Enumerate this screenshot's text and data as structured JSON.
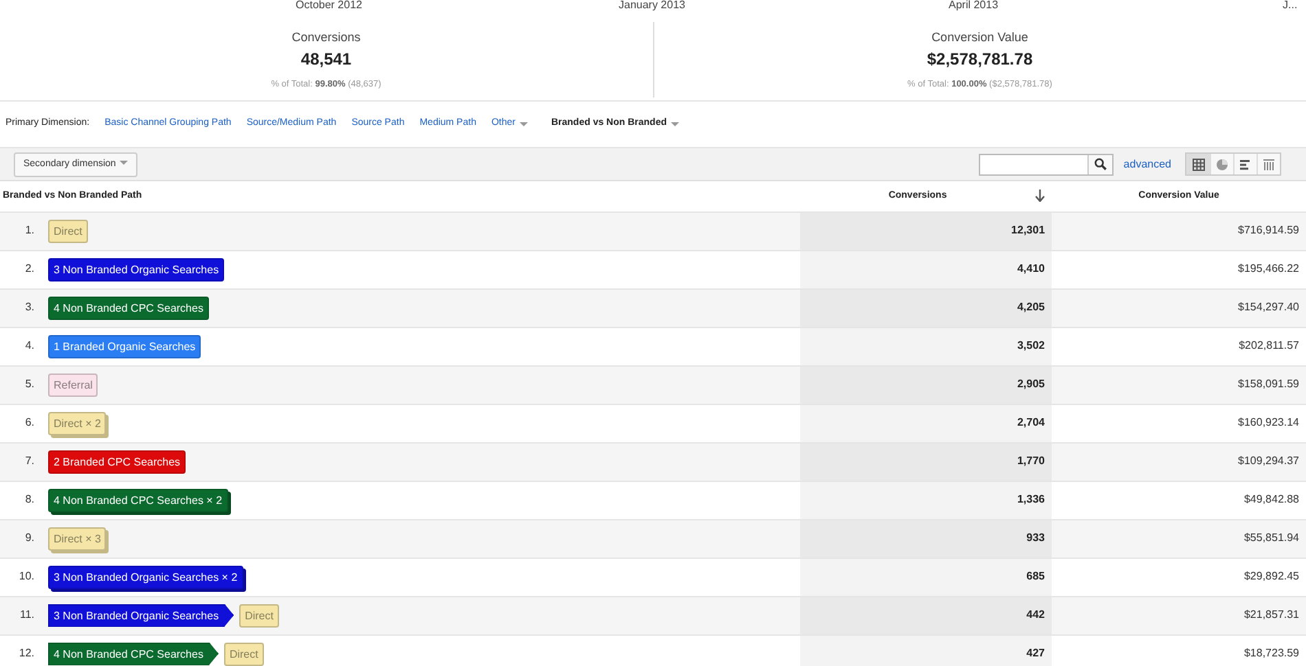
{
  "timeline_labels": [
    "October 2012",
    "January 2013",
    "April 2013",
    "J..."
  ],
  "scorecards": [
    {
      "label": "Conversions",
      "value": "48,541",
      "share": "% of Total: **99.80%** (48,637)"
    },
    {
      "label": "Conversion Value",
      "value": "$2,578,781.78",
      "share": "% of Total: **100.00%** ($2,578,781.78)"
    }
  ],
  "primary_dimension": {
    "label": "Primary Dimension:",
    "options": [
      {
        "label": "Basic Channel Grouping Path",
        "selected": false,
        "dropdown": false
      },
      {
        "label": "Source/Medium Path",
        "selected": false,
        "dropdown": false
      },
      {
        "label": "Source Path",
        "selected": false,
        "dropdown": false
      },
      {
        "label": "Medium Path",
        "selected": false,
        "dropdown": false
      },
      {
        "label": "Other",
        "selected": false,
        "dropdown": true
      },
      {
        "label": "Branded vs Non Branded",
        "selected": true,
        "dropdown": true
      }
    ]
  },
  "secondary_dimension": "Secondary dimension",
  "advanced_link": "advanced",
  "view_buttons": [
    {
      "kind": "table",
      "selected": true
    },
    {
      "kind": "pie",
      "selected": false
    },
    {
      "kind": "bars",
      "selected": false
    },
    {
      "kind": "columns",
      "selected": false
    }
  ],
  "table": {
    "columns": [
      "Branded vs Non Branded Path",
      "Conversions",
      "Conversion Value"
    ],
    "rows": [
      {
        "index": "1.",
        "path": [
          {
            "label": "Direct",
            "color": "#f5e6a8",
            "stacked": false
          }
        ],
        "conversions": "12,301",
        "value": "$716,914.59"
      },
      {
        "index": "2.",
        "path": [
          {
            "label": "3 Non Branded Organic Searches",
            "color": "#1010d8",
            "stacked": false
          }
        ],
        "conversions": "4,410",
        "value": "$195,466.22"
      },
      {
        "index": "3.",
        "path": [
          {
            "label": "4 Non Branded CPC Searches",
            "color": "#0b6b2e",
            "stacked": false
          }
        ],
        "conversions": "4,205",
        "value": "$154,297.40"
      },
      {
        "index": "4.",
        "path": [
          {
            "label": "1 Branded Organic Searches",
            "color": "#2a7df2",
            "stacked": false
          }
        ],
        "conversions": "3,502",
        "value": "$202,811.57"
      },
      {
        "index": "5.",
        "path": [
          {
            "label": "Referral",
            "color": "#fbe3ec",
            "stacked": false
          }
        ],
        "conversions": "2,905",
        "value": "$158,091.59"
      },
      {
        "index": "6.",
        "path": [
          {
            "label": "Direct × 2",
            "color": "#f5e6a8",
            "stacked": true
          }
        ],
        "conversions": "2,704",
        "value": "$160,923.14"
      },
      {
        "index": "7.",
        "path": [
          {
            "label": "2 Branded CPC Searches",
            "color": "#dc0a0a",
            "stacked": false
          }
        ],
        "conversions": "1,770",
        "value": "$109,294.37"
      },
      {
        "index": "8.",
        "path": [
          {
            "label": "4 Non Branded CPC Searches × 2",
            "color": "#0b6b2e",
            "stacked": true
          }
        ],
        "conversions": "1,336",
        "value": "$49,842.88"
      },
      {
        "index": "9.",
        "path": [
          {
            "label": "Direct × 3",
            "color": "#f5e6a8",
            "stacked": true
          }
        ],
        "conversions": "933",
        "value": "$55,851.94"
      },
      {
        "index": "10.",
        "path": [
          {
            "label": "3 Non Branded Organic Searches × 2",
            "color": "#1010d8",
            "stacked": true
          }
        ],
        "conversions": "685",
        "value": "$29,892.45"
      },
      {
        "index": "11.",
        "path": [
          {
            "label": "3 Non Branded Organic Searches",
            "color": "#1010d8",
            "stacked": false
          },
          {
            "label": "Direct",
            "color": "#f5e6a8",
            "stacked": false
          }
        ],
        "conversions": "442",
        "value": "$21,857.31"
      },
      {
        "index": "12.",
        "path": [
          {
            "label": "4 Non Branded CPC Searches",
            "color": "#0b6b2e",
            "stacked": false
          },
          {
            "label": "Direct",
            "color": "#f5e6a8",
            "stacked": false
          }
        ],
        "conversions": "427",
        "value": "$18,723.59"
      }
    ]
  }
}
